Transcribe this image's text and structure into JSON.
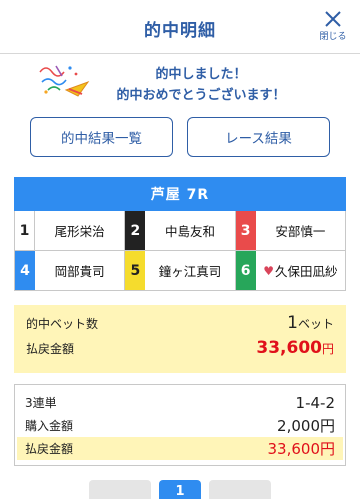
{
  "header": {
    "title": "的中明細",
    "close_label": "閉じる"
  },
  "message": {
    "line1": "的中しました！",
    "line2": "的中おめでとうございます！"
  },
  "buttons": {
    "results_list": "的中結果一覧",
    "race_results": "レース結果"
  },
  "race": {
    "title": "芦屋 7R",
    "entries": [
      {
        "num": "1",
        "name": "尾形栄治"
      },
      {
        "num": "2",
        "name": "中島友和"
      },
      {
        "num": "3",
        "name": "安部慎一"
      },
      {
        "num": "4",
        "name": "岡部貴司"
      },
      {
        "num": "5",
        "name": "鐘ヶ江真司"
      },
      {
        "num": "6",
        "name": "久保田凪紗"
      }
    ]
  },
  "summary": {
    "bets_label": "的中ベット数",
    "bets_value": "1",
    "bets_unit": "ベット",
    "payout_label": "払戻金額",
    "payout_value": "33,600",
    "payout_unit": "円"
  },
  "detail": {
    "type_label": "3連単",
    "combination": "1-4-2",
    "purchase_label": "購入金額",
    "purchase_value": "2,000円",
    "payout_label": "払戻金額",
    "payout_value": "33,600円"
  },
  "pager": {
    "current": "1"
  },
  "colors": {
    "accent": "#2f5ea6",
    "race_header": "#2f8cf0",
    "highlight": "#fff5b8",
    "payout_red": "#e0101a"
  }
}
